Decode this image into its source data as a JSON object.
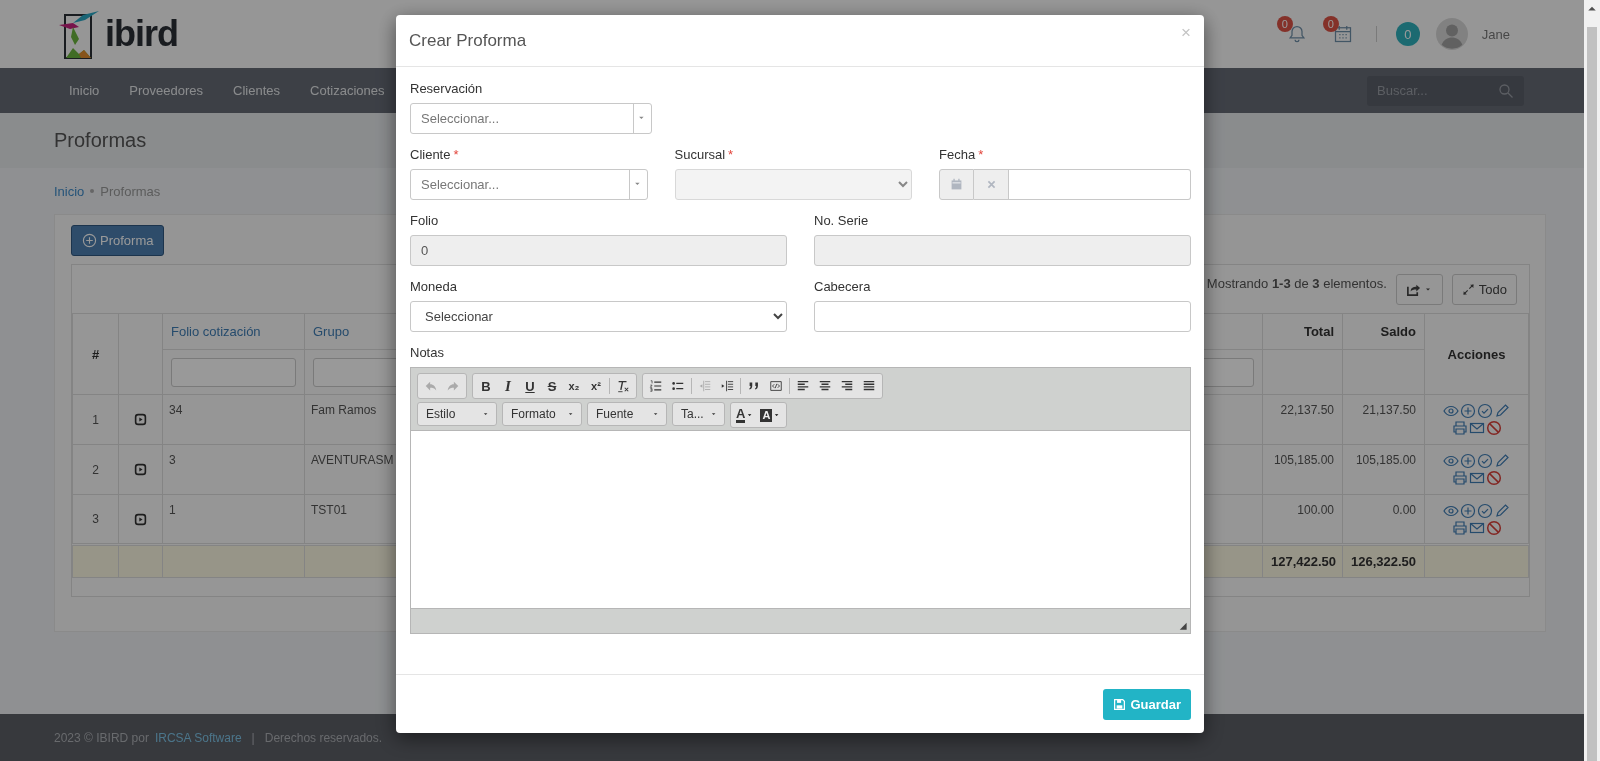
{
  "header": {
    "logo_text": "ibird",
    "notifications": [
      {
        "kind": "bell",
        "count": "0"
      },
      {
        "kind": "calendar",
        "count": "0"
      }
    ],
    "messages_count": "0",
    "user_name": "Jane"
  },
  "nav": {
    "items": [
      "Inicio",
      "Proveedores",
      "Clientes",
      "Cotizaciones"
    ],
    "search": {
      "placeholder": "Buscar..."
    }
  },
  "page_title": "Proformas",
  "breadcrumb": [
    "Inicio",
    "Proformas"
  ],
  "toolbar": {
    "add_button": "Proforma",
    "summary": "Mostrando **1-3** de **3** elementos.",
    "all_button": "Todo"
  },
  "table": {
    "columns": [
      {
        "kind": "index",
        "label": "#"
      },
      {
        "kind": "toggle"
      },
      {
        "kind": "text",
        "label": "Folio cotización",
        "sortable": true,
        "filter": true
      },
      {
        "kind": "text",
        "label": "Grupo",
        "sortable": true,
        "filter": true
      },
      {
        "kind": "covered",
        "filter": true
      },
      {
        "kind": "amount",
        "label": "Total",
        "sortable": false,
        "filter": false
      },
      {
        "kind": "amount",
        "label": "Saldo",
        "sortable": false,
        "filter": false
      },
      {
        "kind": "actions",
        "label": "Acciones"
      }
    ],
    "rows": [
      {
        "values": [
          "1",
          "34",
          "Fam Ramos",
          "22,137.50",
          "21,137.50"
        ]
      },
      {
        "values": [
          "2",
          "3",
          "AVENTURASM",
          "105,185.00",
          "105,185.00"
        ]
      },
      {
        "values": [
          "3",
          "1",
          "TST01",
          "100.00",
          "0.00"
        ]
      }
    ],
    "totals": [
      "127,422.50",
      "126,322.50"
    ]
  },
  "footer": {
    "copyright": "2023 © IBIRD por",
    "link": "IRCSA Software",
    "separator": "|",
    "rights": "Derechos reservados."
  },
  "modal": {
    "title": "Crear Proforma",
    "close": "×",
    "rows": [
      [
        {
          "kind": "select2",
          "label": "Reservación",
          "placeholder": "Seleccionar...",
          "disabled": false
        }
      ],
      [
        {
          "kind": "select2",
          "label": "Cliente",
          "required_mark": "*",
          "placeholder": "Seleccionar...",
          "disabled": false
        },
        {
          "kind": "select",
          "label": "Sucursal",
          "required_mark": "*",
          "disabled": true
        },
        {
          "kind": "date",
          "label": "Fecha",
          "required_mark": "*",
          "disabled": false
        }
      ],
      [
        {
          "kind": "text",
          "label": "Folio",
          "value": "0",
          "disabled": true
        },
        {
          "kind": "text",
          "label": "No. Serie",
          "disabled": true
        }
      ],
      [
        {
          "kind": "select",
          "label": "Moneda",
          "value": "Seleccionar",
          "disabled": false
        },
        {
          "kind": "text",
          "label": "Cabecera",
          "disabled": false
        }
      ]
    ],
    "notes": {
      "label": "Notas",
      "toolbar_groups": [
        [
          {
            "kind": "undo",
            "disabled": true
          },
          {
            "kind": "redo",
            "disabled": true
          }
        ],
        [
          {
            "kind": "bold",
            "label": "B",
            "disabled": false
          },
          {
            "kind": "italic",
            "label": "I",
            "disabled": false
          },
          {
            "kind": "underline",
            "label": "U",
            "disabled": false
          },
          {
            "kind": "strike",
            "label": "S",
            "disabled": false
          },
          {
            "kind": "subscript",
            "label": "x₂",
            "disabled": false
          },
          {
            "kind": "superscript",
            "label": "x²",
            "disabled": false
          },
          {
            "kind": "separator"
          },
          {
            "kind": "remove_format",
            "disabled": false
          }
        ],
        [
          {
            "kind": "numbered_list",
            "disabled": false
          },
          {
            "kind": "bulleted_list",
            "disabled": false
          },
          {
            "kind": "separator"
          },
          {
            "kind": "outdent",
            "disabled": true
          },
          {
            "kind": "indent",
            "disabled": false
          },
          {
            "kind": "separator"
          },
          {
            "kind": "blockquote",
            "disabled": false
          },
          {
            "kind": "div",
            "disabled": false
          },
          {
            "kind": "separator"
          },
          {
            "kind": "align_left",
            "disabled": false
          },
          {
            "kind": "align_center",
            "disabled": false
          },
          {
            "kind": "align_right",
            "disabled": false
          },
          {
            "kind": "justify",
            "disabled": false
          }
        ]
      ],
      "combos": [
        "Estilo",
        "Formato",
        "Fuente",
        "Ta..."
      ],
      "colors": [
        {
          "kind": "text_color",
          "label": "A"
        },
        {
          "kind": "background_color",
          "label": "A"
        }
      ]
    },
    "save_button": "Guardar"
  }
}
